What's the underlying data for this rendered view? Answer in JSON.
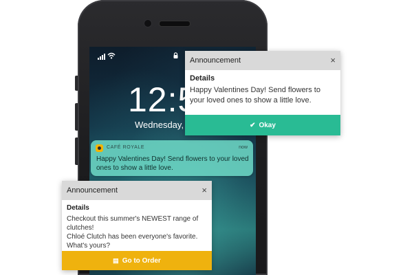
{
  "lockscreen": {
    "time": "12:5",
    "date": "Wednesday,"
  },
  "lock_notification": {
    "app_name": "CAFÉ ROYALE",
    "time": "now",
    "message": "Happy Valentines Day! Send flowers to your loved ones to show a little love."
  },
  "announcement_top": {
    "title": "Announcement",
    "close": "×",
    "details_label": "Details",
    "text": "Happy Valentines Day! Send flowers to your loved ones to show a little love.",
    "action_label": "Okay",
    "action_icon": "✔",
    "accent": "#29bb94"
  },
  "announcement_bottom": {
    "title": "Announcement",
    "close": "×",
    "details_label": "Details",
    "lines": [
      "Checkout this summer's NEWEST range of clutches!",
      "Chloé Clutch has been everyone's favorite. What's yours?"
    ],
    "action_label": "Go to Order",
    "action_icon": "▤",
    "accent": "#efb20e"
  }
}
